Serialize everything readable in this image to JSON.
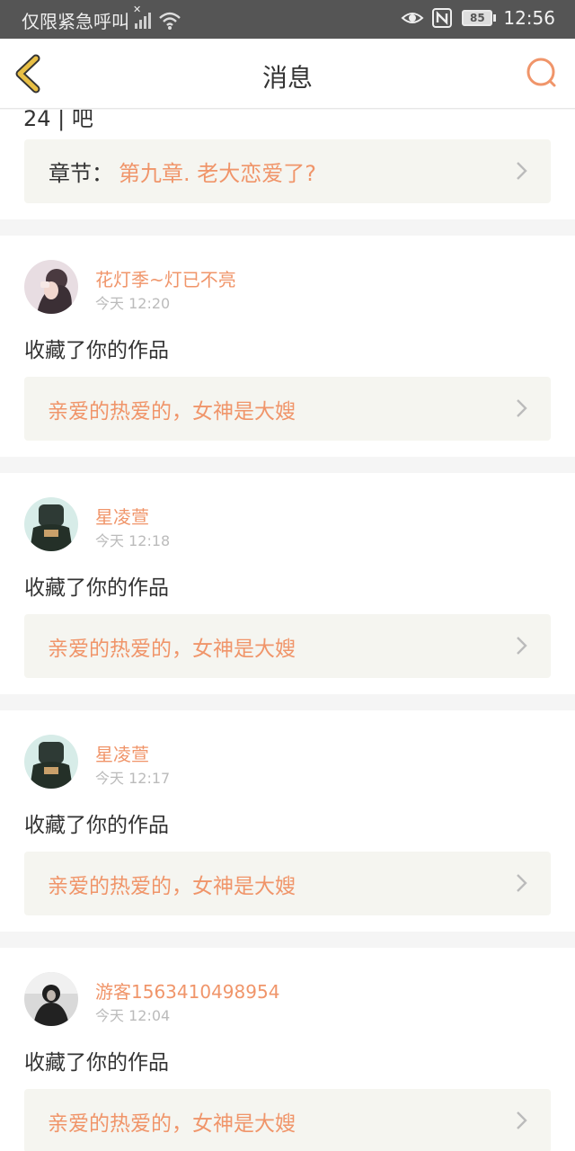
{
  "status_bar": {
    "carrier_text": "仅限紧急呼叫",
    "battery_level": "85",
    "time": "12:56",
    "icons": [
      "signal-x-icon",
      "wifi-icon",
      "eye-icon",
      "nfc-icon",
      "battery-icon"
    ]
  },
  "nav": {
    "title": "消息",
    "back_icon": "chevron-left-icon",
    "search_icon": "search-icon"
  },
  "top_card": {
    "partial_text": "24 | 吧",
    "chapter_prefix": "章节：",
    "chapter_title": "第九章. 老大恋爱了?"
  },
  "messages": [
    {
      "username": "花灯季~灯已不亮",
      "time": "今天 12:20",
      "action": "收藏了你的作品",
      "work": "亲爱的热爱的，女神是大嫂"
    },
    {
      "username": "星凌萱",
      "time": "今天 12:18",
      "action": "收藏了你的作品",
      "work": "亲爱的热爱的，女神是大嫂"
    },
    {
      "username": "星凌萱",
      "time": "今天 12:17",
      "action": "收藏了你的作品",
      "work": "亲爱的热爱的，女神是大嫂"
    },
    {
      "username": "游客1563410498954",
      "time": "今天 12:04",
      "action": "收藏了你的作品",
      "work": "亲爱的热爱的，女神是大嫂"
    }
  ],
  "colors": {
    "accent": "#f0956a",
    "back_icon": "#d9a93a",
    "status_bar_bg": "#555555",
    "card_link_bg": "#f5f5f0"
  }
}
